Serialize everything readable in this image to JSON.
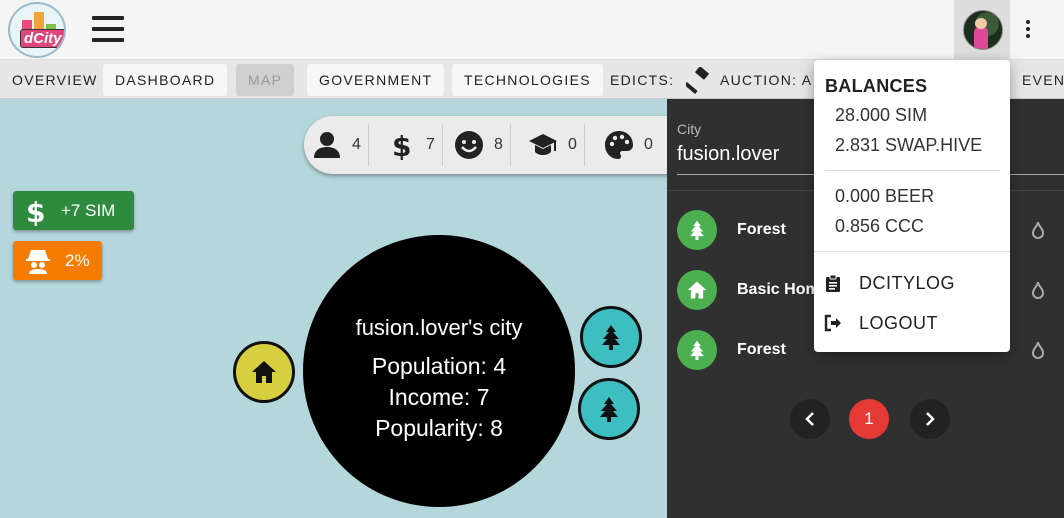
{
  "app": {
    "logo_text": "dCity"
  },
  "nav": {
    "items": [
      {
        "label": "OVERVIEW"
      },
      {
        "label": "DASHBOARD"
      },
      {
        "label": "MAP"
      },
      {
        "label": "GOVERNMENT"
      },
      {
        "label": "TECHNOLOGIES"
      },
      {
        "label": "EDICTS:"
      },
      {
        "label": "AUCTION: A"
      },
      {
        "label": "EVEN"
      }
    ]
  },
  "stats": [
    {
      "icon": "person-icon",
      "value": "4"
    },
    {
      "icon": "dollar-icon",
      "value": "7"
    },
    {
      "icon": "smile-icon",
      "value": "8"
    },
    {
      "icon": "graduation-cap-icon",
      "value": "0"
    },
    {
      "icon": "palette-icon",
      "value": "0"
    }
  ],
  "badges": {
    "sim_income": "+7 SIM",
    "crime_rate": "2%"
  },
  "city": {
    "title": "fusion.lover's city",
    "population": "Population: 4",
    "income": "Income: 7",
    "popularity": "Popularity: 8"
  },
  "panel": {
    "city_label": "City",
    "city_value": "fusion.lover",
    "rows": [
      {
        "icon": "tree-icon",
        "label": "Forest"
      },
      {
        "icon": "home-icon",
        "label": "Basic Hom"
      },
      {
        "icon": "tree-icon",
        "label": "Forest"
      }
    ],
    "current_page": "1"
  },
  "dropdown": {
    "heading": "BALANCES",
    "balances": [
      "28.000 SIM",
      "2.831 SWAP.HIVE",
      "0.000 BEER",
      "0.856 CCC"
    ],
    "menu": [
      {
        "icon": "clipboard-icon",
        "label": "DCITYLOG"
      },
      {
        "icon": "logout-icon",
        "label": "LOGOUT"
      }
    ]
  },
  "colors": {
    "map_bg": "#b4d7dc",
    "panel_bg": "#303030",
    "green": "#2e8b3e",
    "orange": "#f57c00",
    "teal": "#3dbfc2",
    "yellow": "#d6cf3f",
    "red": "#e53935"
  }
}
